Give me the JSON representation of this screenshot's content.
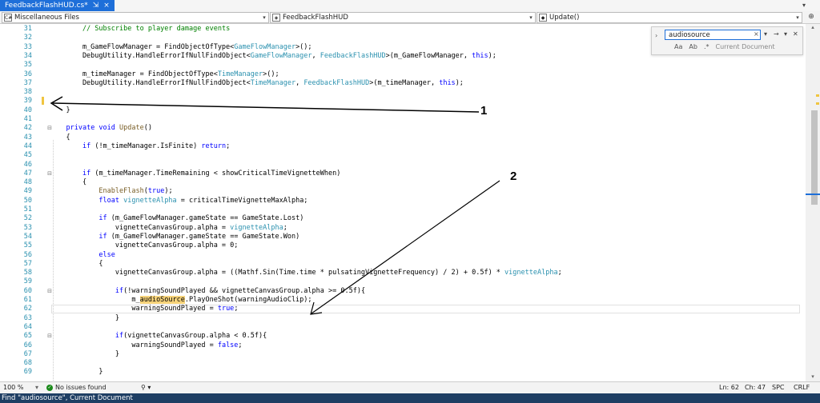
{
  "tab": {
    "title": "FeedbackFlashHUD.cs*",
    "close": "×",
    "pin": "⇲"
  },
  "nav": {
    "project": "Miscellaneous Files",
    "class": "FeedbackFlashHUD",
    "member": "Update()"
  },
  "find": {
    "query": "audiosource",
    "scope": "Current Document",
    "close": "×",
    "next": "→",
    "more": "▾"
  },
  "editor": {
    "lines": [
      {
        "n": "31",
        "html": "        <span class=\"cm\">// Subscribe to player damage events</span>"
      },
      {
        "n": "32",
        "html": ""
      },
      {
        "n": "33",
        "html": "        m_GameFlowManager = FindObjectOfType&lt;<span class=\"ty\">GameFlowManager</span>&gt;();"
      },
      {
        "n": "34",
        "html": "        DebugUtility.HandleErrorIfNullFindObject&lt;<span class=\"ty\">GameFlowManager</span>, <span class=\"ty\">FeedbackFlashHUD</span>&gt;(m_GameFlowManager, <span class=\"kw\">this</span>);"
      },
      {
        "n": "35",
        "html": ""
      },
      {
        "n": "36",
        "html": "        m_timeManager = FindObjectOfType&lt;<span class=\"ty\">TimeManager</span>&gt;();"
      },
      {
        "n": "37",
        "html": "        DebugUtility.HandleErrorIfNullFindObject&lt;<span class=\"ty\">TimeManager</span>, <span class=\"ty\">FeedbackFlashHUD</span>&gt;(m_timeManager, <span class=\"kw\">this</span>);"
      },
      {
        "n": "38",
        "html": ""
      },
      {
        "n": "39",
        "html": ""
      },
      {
        "n": "40",
        "html": "    }"
      },
      {
        "n": "41",
        "html": ""
      },
      {
        "n": "42",
        "html": "    <span class=\"kw\">private void</span> <span class=\"mt\">Update</span>()"
      },
      {
        "n": "43",
        "html": "    {"
      },
      {
        "n": "44",
        "html": "        <span class=\"kw\">if</span> (!m_timeManager.IsFinite) <span class=\"kw\">return</span>;"
      },
      {
        "n": "45",
        "html": ""
      },
      {
        "n": "46",
        "html": ""
      },
      {
        "n": "47",
        "html": "        <span class=\"kw\">if</span> (m_timeManager.TimeRemaining &lt; showCriticalTimeVignetteWhen)"
      },
      {
        "n": "48",
        "html": "        {"
      },
      {
        "n": "49",
        "html": "            <span class=\"mt\">EnableFlash</span>(<span class=\"kw\">true</span>);"
      },
      {
        "n": "50",
        "html": "            <span class=\"kw\">float</span> <span class=\"ty\">vignetteAlpha</span> = criticalTimeVignetteMaxAlpha;"
      },
      {
        "n": "51",
        "html": ""
      },
      {
        "n": "52",
        "html": "            <span class=\"kw\">if</span> (m_GameFlowManager.gameState == GameState.Lost)"
      },
      {
        "n": "53",
        "html": "                vignetteCanvasGroup.alpha = <span class=\"ty\">vignetteAlpha</span>;"
      },
      {
        "n": "54",
        "html": "            <span class=\"kw\">if</span> (m_GameFlowManager.gameState == GameState.Won)"
      },
      {
        "n": "55",
        "html": "                vignetteCanvasGroup.alpha = 0;"
      },
      {
        "n": "56",
        "html": "            <span class=\"kw\">else</span>"
      },
      {
        "n": "57",
        "html": "            {"
      },
      {
        "n": "58",
        "html": "                vignetteCanvasGroup.alpha = ((Mathf.Sin(Time.time * pulsatingVignetteFrequency) / 2) + 0.5f) * <span class=\"ty\">vignetteAlpha</span>;"
      },
      {
        "n": "59",
        "html": ""
      },
      {
        "n": "60",
        "html": "                <span class=\"kw\">if</span>(!warningSoundPlayed &amp;&amp; vignetteCanvasGroup.alpha &gt;= 0.5f){"
      },
      {
        "n": "61",
        "html": "                    m_<span class=\"hl\">audioSource</span>.PlayOneShot(warningAudioClip);"
      },
      {
        "n": "62",
        "html": "                    warningSoundPlayed = <span class=\"kw\">true</span>;"
      },
      {
        "n": "63",
        "html": "                }"
      },
      {
        "n": "64",
        "html": ""
      },
      {
        "n": "65",
        "html": "                <span class=\"kw\">if</span>(vignetteCanvasGroup.alpha &lt; 0.5f){"
      },
      {
        "n": "66",
        "html": "                    warningSoundPlayed = <span class=\"kw\">false</span>;"
      },
      {
        "n": "67",
        "html": "                }"
      },
      {
        "n": "68",
        "html": ""
      },
      {
        "n": "69",
        "html": "            }"
      }
    ]
  },
  "annotations": {
    "one": "1",
    "two": "2"
  },
  "status": {
    "zoom": "100 %",
    "issues": "No issues found",
    "line": "Ln: 62",
    "col": "Ch: 47",
    "spc": "SPC",
    "crlf": "CRLF"
  },
  "bottom": {
    "text": "Find \"audiosource\", Current Document"
  },
  "colors": {
    "accent": "#1e6fd9",
    "highlight": "#f6d37a",
    "linenumber": "#2b91af"
  }
}
